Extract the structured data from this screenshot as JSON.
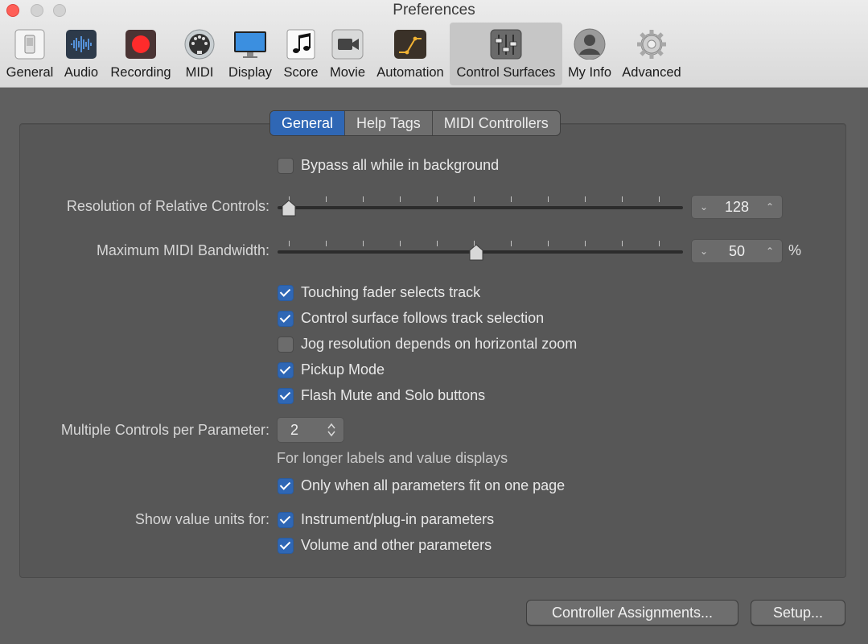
{
  "window": {
    "title": "Preferences"
  },
  "toolbar": [
    {
      "label": "General",
      "icon": "general-switch-icon"
    },
    {
      "label": "Audio",
      "icon": "audio-waveform-icon"
    },
    {
      "label": "Recording",
      "icon": "record-icon"
    },
    {
      "label": "MIDI",
      "icon": "midi-connector-icon"
    },
    {
      "label": "Display",
      "icon": "display-monitor-icon"
    },
    {
      "label": "Score",
      "icon": "score-notes-icon"
    },
    {
      "label": "Movie",
      "icon": "movie-camera-icon"
    },
    {
      "label": "Automation",
      "icon": "automation-curve-icon"
    },
    {
      "label": "Control Surfaces",
      "icon": "control-surfaces-faders-icon",
      "selected": true
    },
    {
      "label": "My Info",
      "icon": "my-info-person-icon"
    },
    {
      "label": "Advanced",
      "icon": "advanced-gear-icon"
    }
  ],
  "tabs": [
    {
      "label": "General",
      "selected": true
    },
    {
      "label": "Help Tags"
    },
    {
      "label": "MIDI Controllers"
    }
  ],
  "settings": {
    "bypass": {
      "label": "Bypass all while in background",
      "checked": false
    },
    "resolution": {
      "label": "Resolution of Relative Controls:",
      "value": "128"
    },
    "bandwidth": {
      "label": "Maximum MIDI Bandwidth:",
      "value": "50",
      "unit": "%"
    },
    "options": [
      {
        "label": "Touching fader selects track",
        "checked": true
      },
      {
        "label": "Control surface follows track selection",
        "checked": true
      },
      {
        "label": "Jog resolution depends on horizontal zoom",
        "checked": false
      },
      {
        "label": "Pickup Mode",
        "checked": true
      },
      {
        "label": "Flash Mute and Solo buttons",
        "checked": true
      }
    ],
    "multiple_controls": {
      "label": "Multiple Controls per Parameter:",
      "value": "2"
    },
    "longer_labels": {
      "note": "For longer labels and value displays",
      "option": "Only when all parameters fit on one page",
      "checked": true
    },
    "value_units": {
      "label": "Show value units for:",
      "options": [
        {
          "label": "Instrument/plug-in parameters",
          "checked": true
        },
        {
          "label": "Volume and other parameters",
          "checked": true
        }
      ]
    }
  },
  "buttons": {
    "assignments": "Controller Assignments...",
    "setup": "Setup..."
  },
  "colors": {
    "accent": "#2f67b5",
    "panel": "#575757",
    "background": "#5f5f5f"
  }
}
